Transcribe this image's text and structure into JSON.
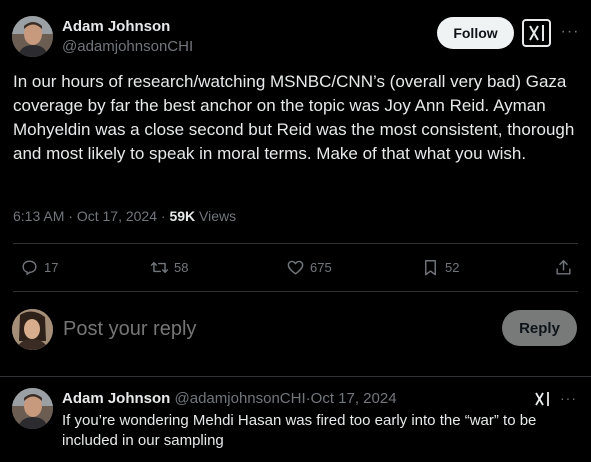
{
  "author": {
    "name": "Adam Johnson",
    "handle": "@adamjohnsonCHI"
  },
  "header": {
    "follow_label": "Follow",
    "more_label": "···"
  },
  "tweet": {
    "text": "In our hours of research/watching MSNBC/CNN’s (overall very bad) Gaza coverage by far the best anchor on the topic was Joy Ann Reid. Ayman Mohyeldin was a close second but Reid was the most consistent, thorough and most likely to speak in moral terms. Make of that what you wish.",
    "time": "6:13 AM",
    "separator": "·",
    "date": "Oct 17, 2024",
    "views_count": "59K",
    "views_label": "Views"
  },
  "actions": {
    "replies": "17",
    "retweets": "58",
    "likes": "675",
    "bookmarks": "52"
  },
  "composer": {
    "placeholder": "Post your reply",
    "reply_label": "Reply"
  },
  "thread_reply": {
    "name": "Adam Johnson",
    "handle": "@adamjohnsonCHI",
    "separator": "·",
    "date": "Oct 17, 2024",
    "more_label": "···",
    "text": "If you’re wondering Mehdi Hasan was fired too early into the “war” to be included in our sampling"
  },
  "colors": {
    "background": "#000000",
    "text_primary": "#e7e9ea",
    "text_muted": "#71767b",
    "divider": "#2f3336",
    "follow_bg": "#eff3f4",
    "reply_btn_bg": "#787a7a"
  }
}
